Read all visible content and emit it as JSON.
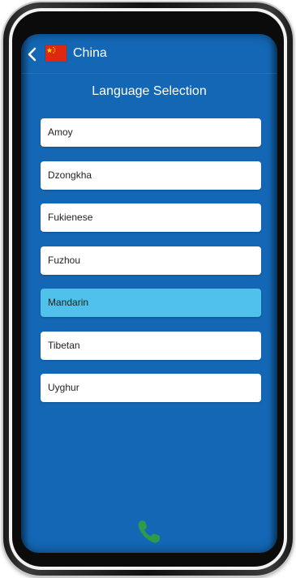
{
  "header": {
    "country": "China",
    "flag_color": "#de2910",
    "back_icon": "chevron-left-icon"
  },
  "page_title": "Language Selection",
  "languages": [
    {
      "label": "Amoy",
      "selected": false
    },
    {
      "label": "Dzongkha",
      "selected": false
    },
    {
      "label": "Fukienese",
      "selected": false
    },
    {
      "label": "Fuzhou",
      "selected": false
    },
    {
      "label": "Mandarin",
      "selected": true
    },
    {
      "label": "Tibetan",
      "selected": false
    },
    {
      "label": "Uyghur",
      "selected": false
    }
  ],
  "call_button": {
    "icon": "phone-icon",
    "color": "#2e9b4a"
  },
  "colors": {
    "background": "#1367b5",
    "selected_item": "#4fc1ea",
    "item": "#ffffff"
  }
}
